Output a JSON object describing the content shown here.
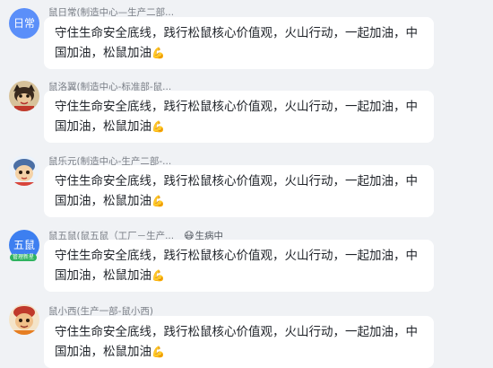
{
  "messages": [
    {
      "sender": "鼠日常(制造中心—生产二部...",
      "avatar_text": "日常",
      "text": "守住生命安全底线，践行松鼠核心价值观，火山行动，一起加油，中国加油，松鼠加油",
      "emoji": "💪"
    },
    {
      "sender": "鼠洛翼(制造中心-标准部-鼠...",
      "text": "守住生命安全底线，践行松鼠核心价值观，火山行动，一起加油，中国加油，松鼠加油",
      "emoji": "💪"
    },
    {
      "sender": "鼠乐元(制造中心-生产二部-...",
      "text": "守住生命安全底线，践行松鼠核心价值观，火山行动，一起加油，中国加油，松鼠加油",
      "emoji": "💪"
    },
    {
      "sender": "鼠五鼠(鼠五鼠（工厂－生产...",
      "avatar_text": "五鼠",
      "avatar_badge": "管理新星",
      "status": "生病中",
      "text": "守住生命安全底线，践行松鼠核心价值观，火山行动，一起加油，中国加油，松鼠加油",
      "emoji": "💪"
    },
    {
      "sender": "鼠小西(生产一部-鼠小西)",
      "text": "守住生命安全底线，践行松鼠核心价值观，火山行动，一起加油，中国加油，松鼠加油",
      "emoji": "💪"
    }
  ],
  "colors": {
    "background": "#f0f2f5",
    "bubble": "#ffffff",
    "avatar_blue": "#5b8ff9",
    "badge_green": "#2fb35f"
  }
}
